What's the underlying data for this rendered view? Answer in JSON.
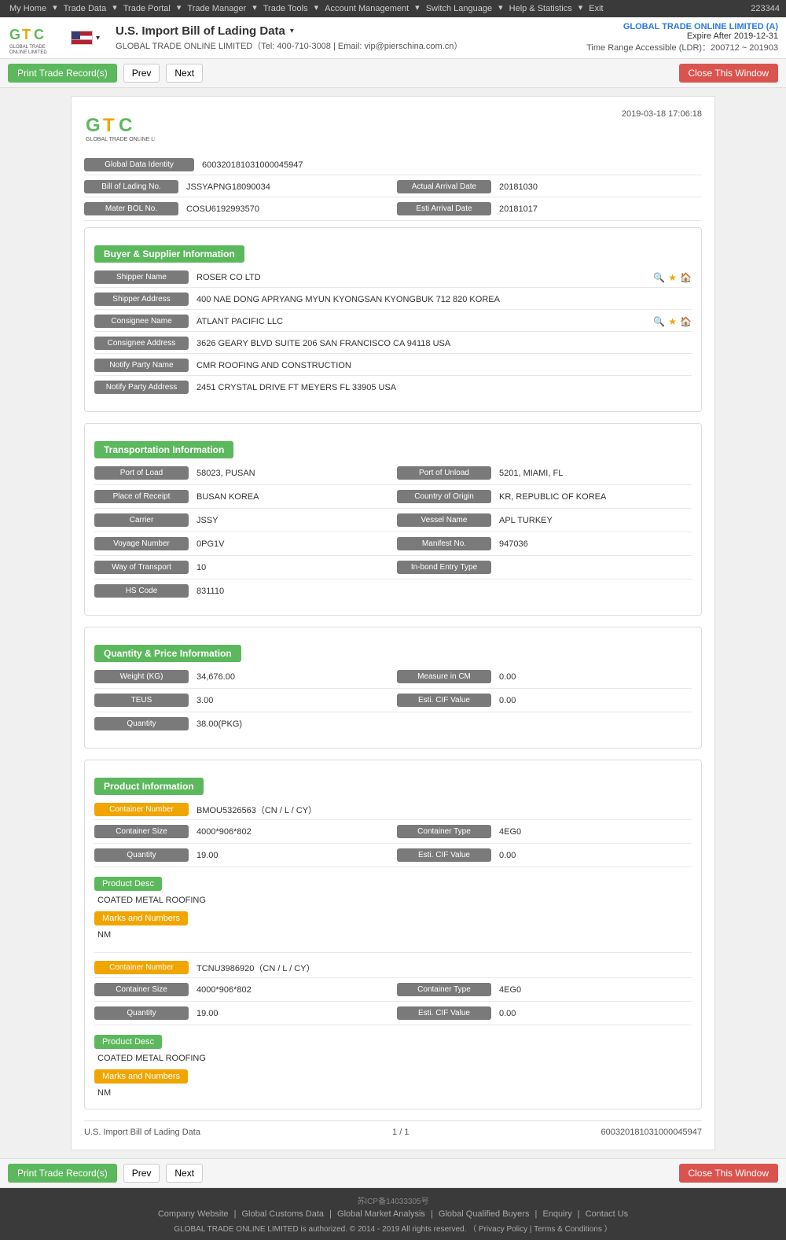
{
  "topnav": {
    "items": [
      "My Home",
      "Trade Data",
      "Trade Portal",
      "Trade Manager",
      "Trade Tools",
      "Account Management",
      "Switch Language",
      "Help & Statistics",
      "Exit"
    ],
    "user_id": "223344"
  },
  "header": {
    "title": "U.S. Import Bill of Lading Data",
    "subtitle": "GLOBAL TRADE ONLINE LIMITED（Tel: 400-710-3008 | Email: vip@pierschina.com.cn）",
    "company": "GLOBAL TRADE ONLINE LIMITED (A)",
    "expire": "Expire After 2019-12-31",
    "time_range": "Time Range Accessible (LDR)：200712 ~ 201903"
  },
  "toolbar": {
    "print_label": "Print Trade Record(s)",
    "prev_label": "Prev",
    "next_label": "Next",
    "close_label": "Close This Window"
  },
  "record": {
    "datetime": "2019-03-18 17:06:18",
    "global_data_identity_label": "Global Data Identity",
    "global_data_identity_value": "600320181031000045947",
    "bol_no_label": "Bill of Lading No.",
    "bol_no_value": "JSSYAPNG18090034",
    "actual_arrival_label": "Actual Arrival Date",
    "actual_arrival_value": "20181030",
    "master_bol_label": "Mater BOL No.",
    "master_bol_value": "COSU6192993570",
    "esti_arrival_label": "Esti Arrival Date",
    "esti_arrival_value": "20181017"
  },
  "buyer_supplier": {
    "section_title": "Buyer & Supplier Information",
    "shipper_name_label": "Shipper Name",
    "shipper_name_value": "ROSER CO LTD",
    "shipper_address_label": "Shipper Address",
    "shipper_address_value": "400 NAE DONG APRYANG MYUN KYONGSAN KYONGBUK 712 820 KOREA",
    "consignee_name_label": "Consignee Name",
    "consignee_name_value": "ATLANT PACIFIC LLC",
    "consignee_address_label": "Consignee Address",
    "consignee_address_value": "3626 GEARY BLVD SUITE 206 SAN FRANCISCO CA 94118 USA",
    "notify_party_name_label": "Notify Party Name",
    "notify_party_name_value": "CMR ROOFING AND CONSTRUCTION",
    "notify_party_address_label": "Notify Party Address",
    "notify_party_address_value": "2451 CRYSTAL DRIVE FT MEYERS FL 33905 USA"
  },
  "transportation": {
    "section_title": "Transportation Information",
    "port_of_load_label": "Port of Load",
    "port_of_load_value": "58023, PUSAN",
    "port_of_unload_label": "Port of Unload",
    "port_of_unload_value": "5201, MIAMI, FL",
    "place_of_receipt_label": "Place of Receipt",
    "place_of_receipt_value": "BUSAN KOREA",
    "country_of_origin_label": "Country of Origin",
    "country_of_origin_value": "KR, REPUBLIC OF KOREA",
    "carrier_label": "Carrier",
    "carrier_value": "JSSY",
    "vessel_name_label": "Vessel Name",
    "vessel_name_value": "APL TURKEY",
    "voyage_number_label": "Voyage Number",
    "voyage_number_value": "0PG1V",
    "manifest_no_label": "Manifest No.",
    "manifest_no_value": "947036",
    "way_of_transport_label": "Way of Transport",
    "way_of_transport_value": "10",
    "inbond_entry_label": "In-bond Entry Type",
    "inbond_entry_value": "",
    "hs_code_label": "HS Code",
    "hs_code_value": "831110"
  },
  "quantity_price": {
    "section_title": "Quantity & Price Information",
    "weight_label": "Weight (KG)",
    "weight_value": "34,676.00",
    "measure_cm_label": "Measure in CM",
    "measure_cm_value": "0.00",
    "teus_label": "TEUS",
    "teus_value": "3.00",
    "esti_cif_label": "Esti. CIF Value",
    "esti_cif_value": "0.00",
    "quantity_label": "Quantity",
    "quantity_value": "38.00(PKG)"
  },
  "product_info": {
    "section_title": "Product Information",
    "containers": [
      {
        "container_number_label": "Container Number",
        "container_number_value": "BMOU5326563（CN / L / CY）",
        "container_size_label": "Container Size",
        "container_size_value": "4000*906*802",
        "container_type_label": "Container Type",
        "container_type_value": "4EG0",
        "quantity_label": "Quantity",
        "quantity_value": "19.00",
        "esti_cif_label": "Esti. CIF Value",
        "esti_cif_value": "0.00",
        "product_desc_label": "Product Desc",
        "product_desc_value": "COATED METAL ROOFING",
        "marks_label": "Marks and Numbers",
        "marks_value": "NM"
      },
      {
        "container_number_label": "Container Number",
        "container_number_value": "TCNU3986920（CN / L / CY）",
        "container_size_label": "Container Size",
        "container_size_value": "4000*906*802",
        "container_type_label": "Container Type",
        "container_type_value": "4EG0",
        "quantity_label": "Quantity",
        "quantity_value": "19.00",
        "esti_cif_label": "Esti. CIF Value",
        "esti_cif_value": "0.00",
        "product_desc_label": "Product Desc",
        "product_desc_value": "COATED METAL ROOFING",
        "marks_label": "Marks and Numbers",
        "marks_value": "NM"
      }
    ]
  },
  "doc_footer": {
    "left": "U.S. Import Bill of Lading Data",
    "center": "1 / 1",
    "right": "600320181031000045947"
  },
  "site_footer": {
    "icp": "苏ICP备14033305号",
    "links": [
      "Company Website",
      "Global Customs Data",
      "Global Market Analysis",
      "Global Qualified Buyers",
      "Enquiry",
      "Contact Us"
    ],
    "copyright": "GLOBAL TRADE ONLINE LIMITED is authorized. © 2014 - 2019 All rights reserved. （ Privacy Policy | Terms & Conditions ）"
  }
}
